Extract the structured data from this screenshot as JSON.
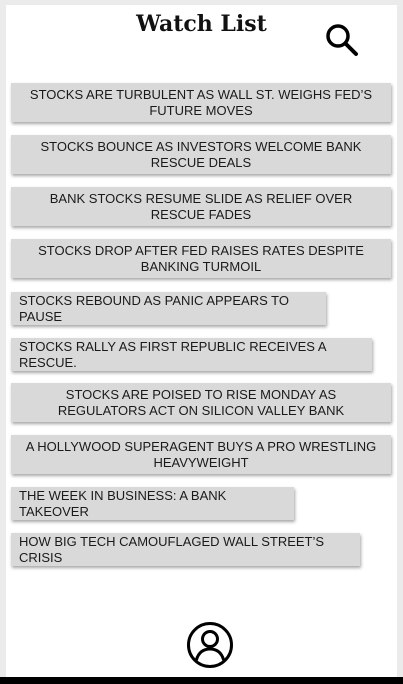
{
  "header": {
    "title": "Watch List"
  },
  "icons": {
    "search": "search-icon",
    "profile": "user-avatar-icon"
  },
  "news": [
    {
      "label": "STOCKS ARE TURBULENT AS WALL ST. WEIGHS FED’S FUTURE MOVES"
    },
    {
      "label": "STOCKS BOUNCE AS INVESTORS WELCOME BANK RESCUE DEALS"
    },
    {
      "label": "BANK STOCKS RESUME SLIDE AS RELIEF OVER RESCUE FADES"
    },
    {
      "label": "STOCKS DROP AFTER FED RAISES RATES DESPITE BANKING TURMOIL"
    },
    {
      "label": "STOCKS REBOUND AS PANIC APPEARS TO PAUSE"
    },
    {
      "label": "STOCKS RALLY AS FIRST REPUBLIC RECEIVES A RESCUE."
    },
    {
      "label": "STOCKS ARE POISED TO RISE MONDAY AS REGULATORS ACT ON SILICON VALLEY BANK"
    },
    {
      "label": "A HOLLYWOOD SUPERAGENT BUYS A PRO WRESTLING HEAVYWEIGHT"
    },
    {
      "label": "THE WEEK IN BUSINESS: A BANK TAKEOVER"
    },
    {
      "label": "HOW BIG TECH CAMOUFLAGED WALL STREET’S CRISIS"
    }
  ],
  "colors": {
    "item_background": "#d9d9d9",
    "page_background": "#ffffff",
    "bottom_bar": "#000000"
  }
}
